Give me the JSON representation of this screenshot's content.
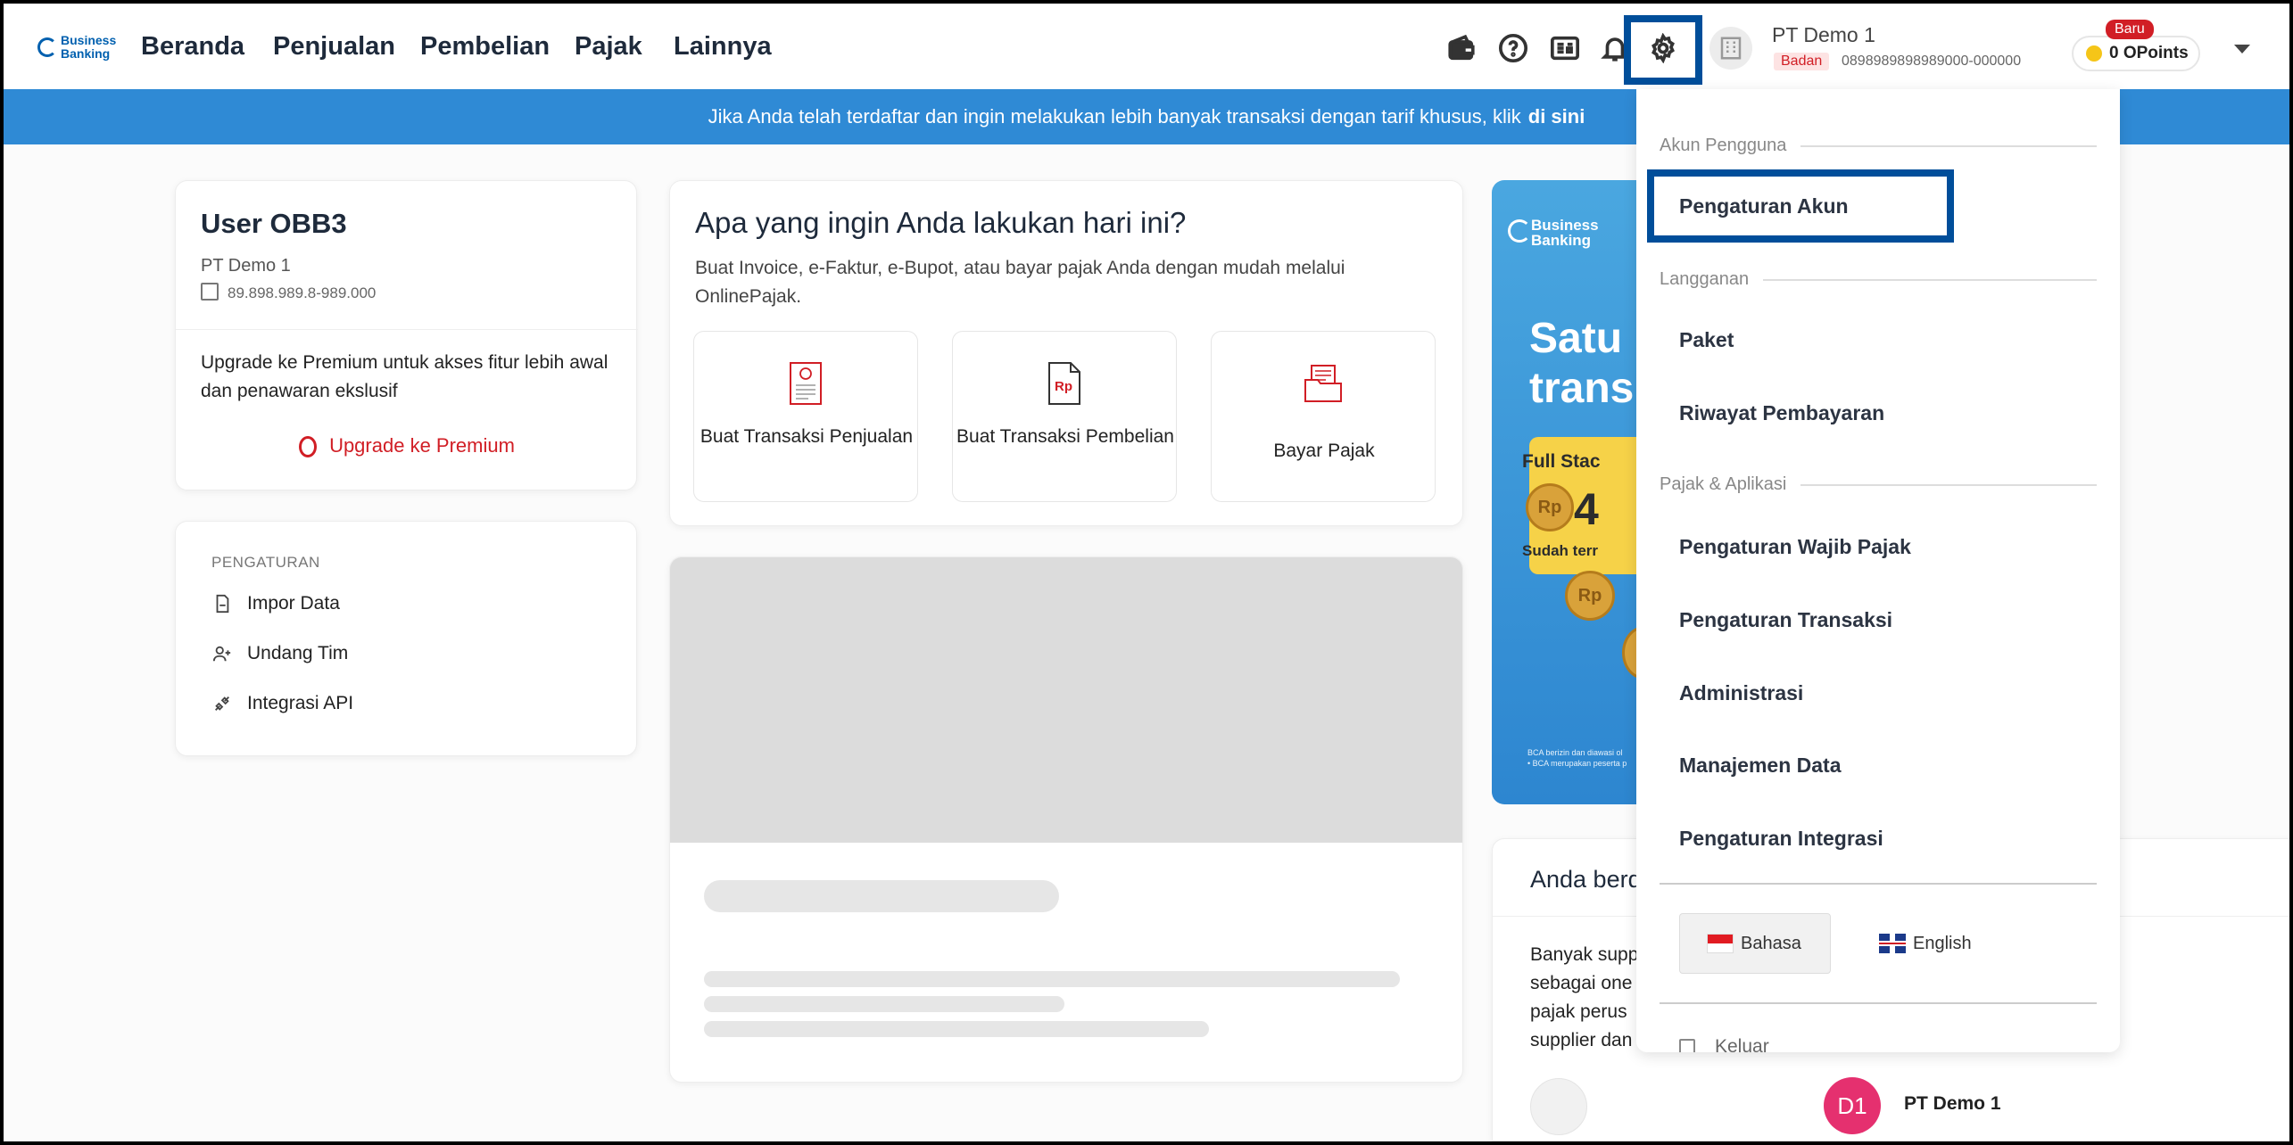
{
  "header": {
    "logo_line1": "Business",
    "logo_line2": "Banking",
    "nav": [
      "Beranda",
      "Penjualan",
      "Pembelian",
      "Pajak",
      "Lainnya"
    ],
    "company_name": "PT Demo 1",
    "company_type": "Badan",
    "company_npwp": "0898989898989000-000000",
    "points_label": "0 OPoints",
    "new_badge": "Baru"
  },
  "banner": {
    "text": "Jika Anda telah terdaftar dan ingin melakukan lebih banyak transaksi dengan tarif khusus, klik",
    "link": "di sini"
  },
  "user_card": {
    "name": "User OBB3",
    "company": "PT Demo 1",
    "npwp": "89.898.989.8-989.000",
    "upgrade_text": "Upgrade ke Premium untuk akses fitur lebih awal dan penawaran ekslusif",
    "upgrade_link": "Upgrade ke Premium"
  },
  "settings_card": {
    "title": "PENGATURAN",
    "items": [
      "Impor Data",
      "Undang Tim",
      "Integrasi API"
    ]
  },
  "action_card": {
    "title": "Apa yang ingin Anda lakukan hari ini?",
    "subtitle": "Buat Invoice, e-Faktur, e-Bupot, atau bayar pajak Anda dengan mudah melalui OnlinePajak.",
    "tiles": [
      {
        "label": "Buat Transaksi Penjualan",
        "icon": "sales-receipt-icon"
      },
      {
        "label": "Buat Transaksi Pembelian",
        "icon": "purchase-rp-icon"
      },
      {
        "label": "Bayar Pajak",
        "icon": "tax-folder-icon"
      }
    ]
  },
  "promo": {
    "logo_line1": "Business",
    "logo_line2": "Banking",
    "title_line1": "Satu",
    "title_line2": "trans",
    "box_head": "Full Stac",
    "box_num": "4",
    "box_foot": "Sudah terr",
    "fine_line1": "BCA berizin dan diawasi ol",
    "fine_line2": "• BCA merupakan peserta p"
  },
  "anda_card": {
    "title": "Anda berd",
    "text": "Banyak supp sebagai one pajak perus supplier dan",
    "avatar_initials": "D1",
    "avatar_name": "PT Demo 1"
  },
  "dropdown": {
    "section_account": "Akun Pengguna",
    "account_settings": "Pengaturan Akun",
    "section_subscription": "Langganan",
    "package": "Paket",
    "payment_history": "Riwayat Pembayaran",
    "section_tax": "Pajak & Aplikasi",
    "tax_items": [
      "Pengaturan Wajib Pajak",
      "Pengaturan Transaksi",
      "Administrasi",
      "Manajemen Data",
      "Pengaturan Integrasi"
    ],
    "lang_bahasa": "Bahasa",
    "lang_english": "English",
    "logout": "Keluar"
  },
  "colors": {
    "brand_blue": "#0060af",
    "banner_blue": "#2f8ad5",
    "highlight_box": "#004e9a",
    "accent_red": "#d11e25",
    "avatar_pink": "#e5306f"
  }
}
